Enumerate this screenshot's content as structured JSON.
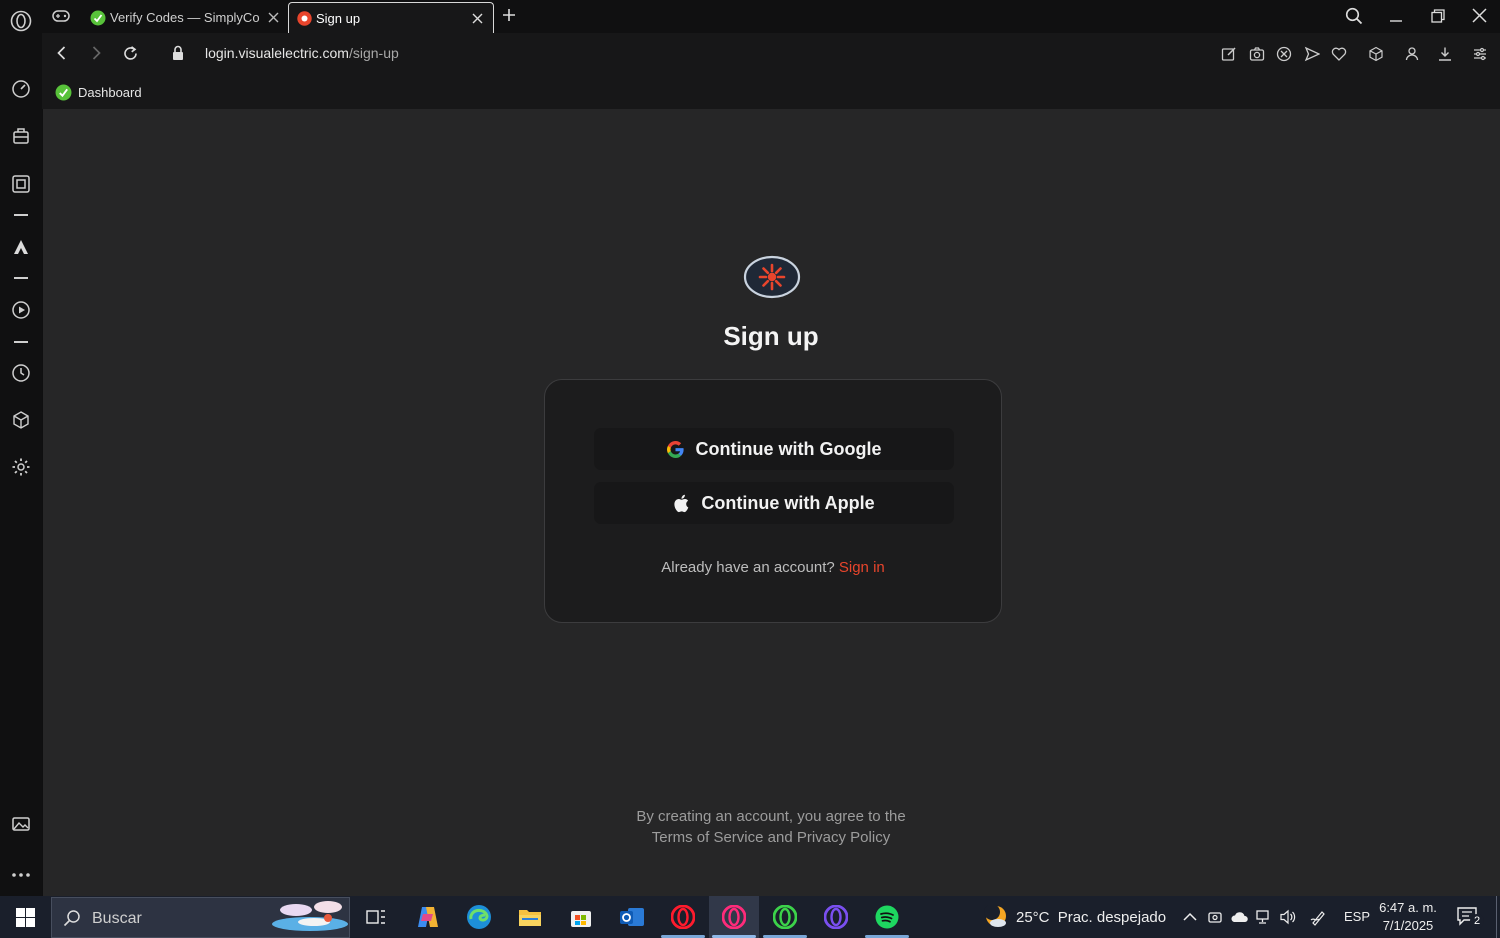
{
  "browser": {
    "tabs": [
      {
        "title": "Verify Codes — SimplyCodes",
        "favicon": "simplycodes-icon",
        "active": false
      },
      {
        "title": "Sign up",
        "favicon": "visualelectric-icon",
        "active": true
      }
    ],
    "address": {
      "url_host": "login.visualelectric.com",
      "url_path": "/sign-up"
    },
    "bookmarks": [
      {
        "label": "Dashboard",
        "icon": "simplycodes-icon"
      }
    ]
  },
  "page": {
    "heading": "Sign up",
    "google_button": "Continue with Google",
    "apple_button": "Continue with Apple",
    "signin_prompt": "Already have an account?",
    "signin_link": "Sign in",
    "terms_line1": "By creating an account, you agree to the",
    "terms_line2": "Terms of Service and Privacy Policy",
    "colors": {
      "accent": "#e8452c",
      "background": "#262627",
      "card": "#1c1c1d"
    }
  },
  "taskbar": {
    "search_placeholder": "Buscar",
    "weather": {
      "temp": "25°C",
      "condition": "Prac. despejado"
    },
    "language": "ESP",
    "time": "6:47 a. m.",
    "date": "7/1/2025",
    "notifications_count": "2"
  }
}
